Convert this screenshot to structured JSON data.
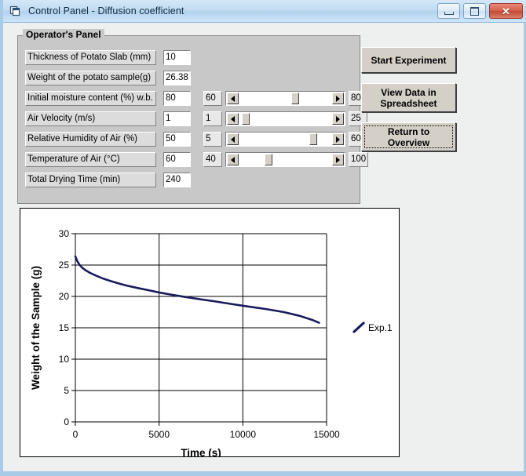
{
  "window": {
    "title": "Control Panel - Diffusion coefficient",
    "icon": "window-document-icon",
    "minimize_label": "–",
    "maximize_label": "□",
    "close_label": "✕",
    "body_color": "#eef0ef",
    "frame_color": "#a8cbe8"
  },
  "operator_panel": {
    "legend": "Operator's Panel",
    "background": "#c8c8c8",
    "fields": [
      {
        "label": "Thickness of Potato Slab (mm)",
        "value": "10"
      },
      {
        "label": "Weight of the potato sample(g)",
        "value": "26.38"
      },
      {
        "label": "Initial moisture content (%) w.b.",
        "value": "80"
      },
      {
        "label": "Air Velocity (m/s)",
        "value": "1"
      },
      {
        "label": "Relative Humidity of Air (%)",
        "value": "50"
      },
      {
        "label": "Temperature of  Air (°C)",
        "value": "60"
      },
      {
        "label": "Total Drying Time (min)",
        "value": "240"
      }
    ],
    "sliders": [
      {
        "min": "60",
        "max": "80",
        "thumb_pct": 60
      },
      {
        "min": "1",
        "max": "25",
        "thumb_pct": 4
      },
      {
        "min": "5",
        "max": "60",
        "thumb_pct": 81
      },
      {
        "min": "40",
        "max": "100",
        "thumb_pct": 30
      }
    ]
  },
  "buttons": {
    "start": "Start Experiment",
    "view_data_line1": "View Data in",
    "view_data_line2": "Spreadsheet",
    "return_line1": "Return to",
    "return_line2": "Overview"
  },
  "chart_data": {
    "type": "line",
    "title": "",
    "xlabel": "Time (s)",
    "ylabel": "Weight of the Sample (g)",
    "xlim": [
      0,
      15000
    ],
    "ylim": [
      0,
      30
    ],
    "xticks": [
      0,
      5000,
      10000,
      15000
    ],
    "yticks": [
      0,
      5,
      10,
      15,
      20,
      25,
      30
    ],
    "xtick_labels": [
      "0",
      "5000",
      "10000",
      "15000"
    ],
    "ytick_labels": [
      "0",
      "5",
      "10",
      "15",
      "20",
      "25",
      "30"
    ],
    "grid": true,
    "legend_position": "right",
    "series": [
      {
        "name": "Exp.1",
        "color": "#1a1a5e",
        "x": [
          0,
          120,
          260,
          420,
          620,
          880,
          1200,
          1600,
          2050,
          2550,
          3100,
          3700,
          4350,
          5050,
          5800,
          6600,
          7450,
          8350,
          9300,
          10300,
          11350,
          12450,
          13400,
          14200,
          14550
        ],
        "y": [
          26.38,
          25.6,
          25.0,
          24.55,
          24.15,
          23.75,
          23.35,
          22.9,
          22.5,
          22.1,
          21.7,
          21.35,
          21.0,
          20.6,
          20.25,
          19.9,
          19.55,
          19.2,
          18.8,
          18.4,
          18.0,
          17.5,
          16.9,
          16.2,
          15.8
        ]
      }
    ]
  }
}
